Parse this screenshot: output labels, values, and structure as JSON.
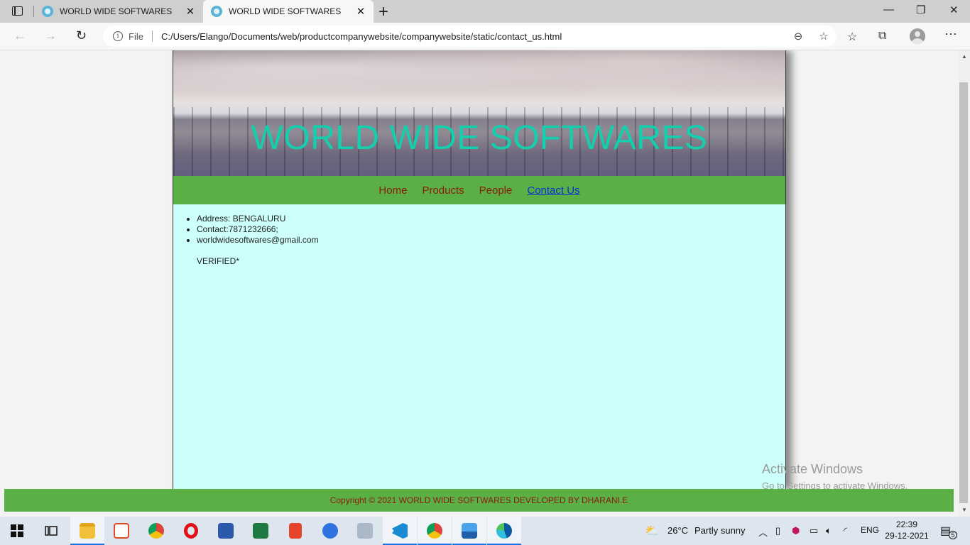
{
  "browser": {
    "tabs": [
      {
        "title": "WORLD WIDE SOFTWARES",
        "active": false
      },
      {
        "title": "WORLD WIDE SOFTWARES",
        "active": true
      }
    ],
    "address": {
      "scheme_label": "File",
      "url": "C:/Users/Elango/Documents/web/productcompanywebsite/companywebsite/static/contact_us.html"
    }
  },
  "site": {
    "heading": "WORLD WIDE SOFTWARES",
    "nav": [
      {
        "label": "Home"
      },
      {
        "label": "Products"
      },
      {
        "label": "People"
      },
      {
        "label": "Contact Us",
        "current": true
      }
    ],
    "contact": [
      "Address: BENGALURU",
      "Contact:7871232666;",
      "worldwidesoftwares@gmail.com"
    ],
    "verified": "VERIFIED*",
    "footer": "Copyright © 2021 WORLD WIDE SOFTWARES DEVELOPED BY DHARANI.E",
    "colors": {
      "heading": "#14cfae",
      "nav_bg": "#5ab044",
      "content_bg": "#ccfffb",
      "link": "#8b1a10",
      "current_link": "#0a2ed6"
    }
  },
  "watermark": {
    "line1": "Activate Windows",
    "line2": "Go to Settings to activate Windows."
  },
  "taskbar": {
    "apps": [
      "start-icon",
      "task-view-icon",
      "file-explorer-icon",
      "presentation-app-icon",
      "chrome-icon",
      "opera-icon",
      "word-icon",
      "excel-icon",
      "office-icon",
      "media-player-icon",
      "disney-plus-icon",
      "vscode-icon",
      "chrome-profile-icon",
      "photos-icon",
      "edge-icon"
    ],
    "weather": {
      "temp": "26°C",
      "condition": "Partly sunny"
    },
    "language": "ENG",
    "time": "22:39",
    "date": "29-12-2021",
    "notification_count": "5"
  }
}
